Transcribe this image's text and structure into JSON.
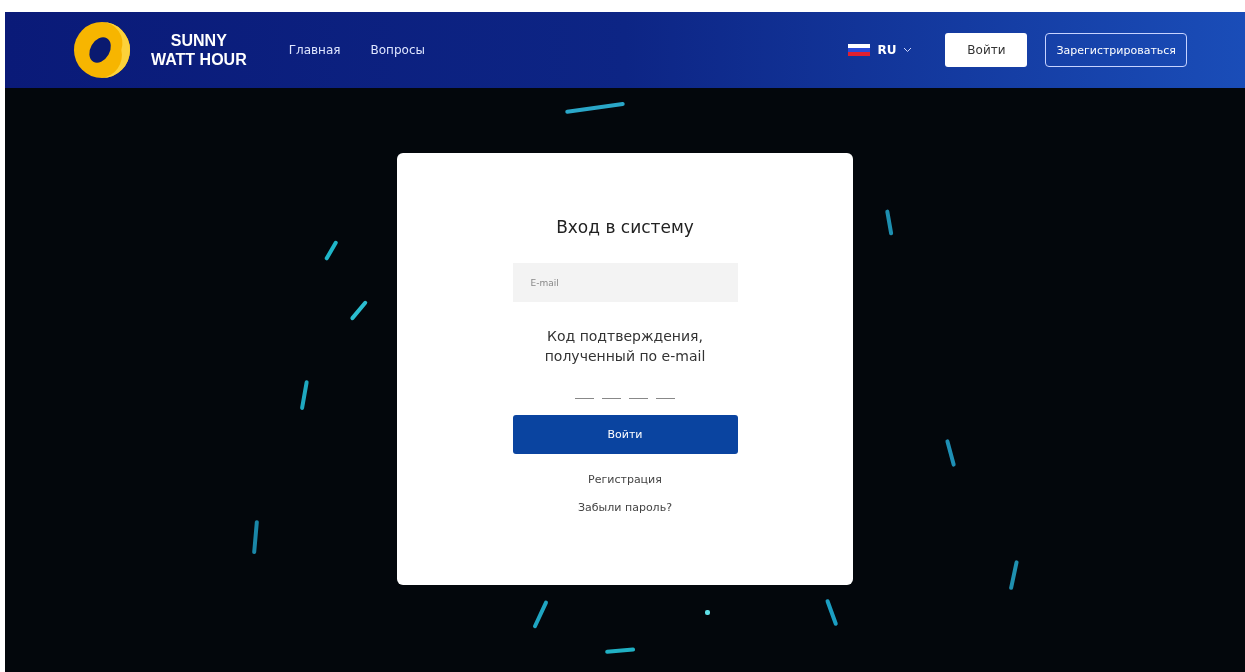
{
  "header": {
    "logo_text": [
      "SUNNY",
      "WATT HOUR"
    ],
    "nav": [
      {
        "label": "Главная"
      },
      {
        "label": "Вопросы"
      }
    ],
    "language": "RU",
    "login_button": "Войти",
    "register_button": "Зарегистрироваться"
  },
  "login_card": {
    "title": "Вход в систему",
    "email": {
      "placeholder": "E-mail"
    },
    "code_label": "Код подтверждения, полученный по e-mail",
    "submit": "Войти",
    "links": [
      "Регистрация",
      "Забыли пароль?"
    ]
  }
}
